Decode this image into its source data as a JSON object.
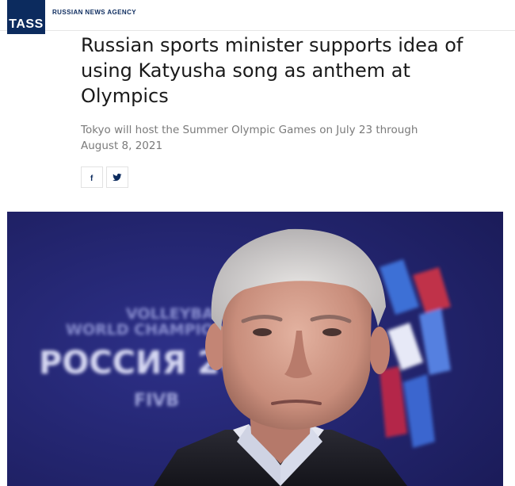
{
  "header": {
    "logo_text": "TASS",
    "agency_name": "RUSSIAN NEWS AGENCY"
  },
  "article": {
    "title": "Russian sports minister supports idea of using Katyusha song as anthem at Olympics",
    "subtitle": "Tokyo will host the Summer Olympic Games on July 23 through August 8, 2021"
  },
  "share": {
    "facebook_icon": "f",
    "twitter_icon": "twitter-bird"
  },
  "photo": {
    "backdrop_line1": "VOLLEYBALL",
    "backdrop_line2": "WORLD CHAMPIONSHIP",
    "backdrop_main": "РОССИЯ 20",
    "backdrop_logo": "FIVB"
  },
  "colors": {
    "brand": "#0c2b5e",
    "backdrop": "#23256e"
  }
}
